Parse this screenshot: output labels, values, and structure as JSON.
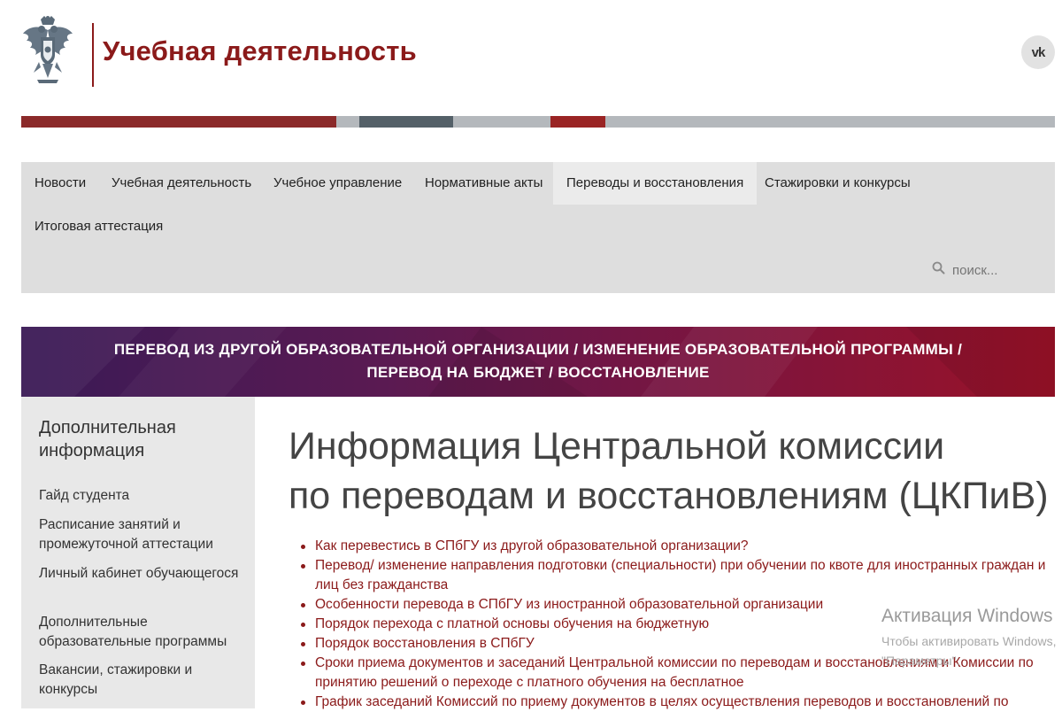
{
  "header": {
    "site_title": "Учебная деятельность",
    "social": {
      "label": "vk",
      "icon": "vk-icon"
    }
  },
  "brand_colors": {
    "accent": "#8b1a1a",
    "stripe": [
      "#8b2a2a",
      "#b4b8bc",
      "#546068",
      "#b4b8bc",
      "#9a2424",
      "#b4b8bc"
    ]
  },
  "nav": {
    "items": [
      {
        "label": "Новости",
        "active": false
      },
      {
        "label": "Учебная деятельность",
        "active": false
      },
      {
        "label": "Учебное управление",
        "active": false
      },
      {
        "label": "Нормативные акты",
        "active": false
      },
      {
        "label": "Переводы и восстановления",
        "active": true
      },
      {
        "label": "Стажировки и конкурсы",
        "active": false
      },
      {
        "label": "Итоговая аттестация",
        "active": false
      }
    ],
    "search": {
      "placeholder": "поиск...",
      "icon": "search-icon"
    }
  },
  "banner": {
    "line1": "ПЕРЕВОД ИЗ ДРУГОЙ ОБРАЗОВАТЕЛЬНОЙ ОРГАНИЗАЦИИ / ИЗМЕНЕНИЕ ОБРАЗОВАТЕЛЬНОЙ ПРОГРАММЫ /",
    "line2": "ПЕРЕВОД НА БЮДЖЕТ / ВОССТАНОВЛЕНИЕ"
  },
  "sidebar": {
    "heading": "Дополнительная информация",
    "links": [
      "Гайд студента",
      "Расписание занятий и промежуточной аттестации",
      "Личный кабинет обучающегося",
      "Дополнительные образовательные программы",
      "Вакансии, стажировки и конкурсы"
    ]
  },
  "main": {
    "title_line1": "Информация Центральной комиссии",
    "title_line2": "по переводам и восстановлениям (ЦКПиВ)",
    "links": [
      "Как перевестись в СПбГУ из другой образовательной организации?",
      "Перевод/ изменение направления подготовки (специальности) при обучении по квоте для иностранных граждан и лиц без гражданства",
      "Особенности перевода в СПбГУ из иностранной образовательной организации",
      "Порядок перехода с платной основы обучения на бюджетную",
      "Порядок восстановления в СПбГУ",
      "Сроки приема документов и заседаний Центральной комиссии по переводам и восстановлениям и Комиссии по принятию решений о переходе с платного обучения на бесплатное",
      "График заседаний Комиссий по приему документов в целях осуществления переводов и восстановлений по"
    ]
  },
  "watermark": {
    "title": "Активация Windows",
    "line1": "Чтобы активировать Windows,",
    "line2": "\"Параметры\"."
  }
}
